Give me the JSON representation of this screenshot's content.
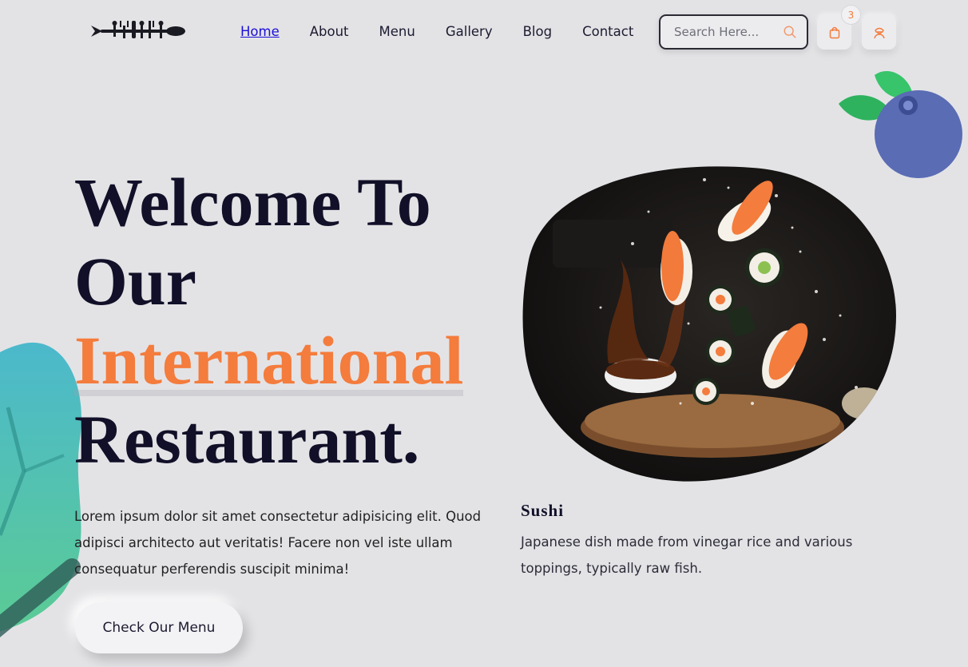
{
  "header": {
    "nav": [
      {
        "label": "Home",
        "active": true
      },
      {
        "label": "About"
      },
      {
        "label": "Menu"
      },
      {
        "label": "Gallery"
      },
      {
        "label": "Blog"
      },
      {
        "label": "Contact"
      }
    ],
    "search": {
      "placeholder": "Search Here..."
    },
    "cart_count": "3",
    "icons": {
      "search": "search-icon",
      "cart": "shopping-bag-icon",
      "user": "user-icon",
      "logo": "cutlery-fish-logo"
    }
  },
  "hero": {
    "title_line1": "Welcome To",
    "title_line2": "Our",
    "title_accent": "International",
    "title_line4": "Restaurant.",
    "description": "Lorem ipsum dolor sit amet consectetur adipisicing elit. Quod adipisci architecto aut veritatis! Facere non vel iste ullam consequatur perferendis suscipit minima!",
    "cta_label": "Check Our Menu"
  },
  "dish": {
    "name": "Sushi",
    "description": "Japanese dish made from vinegar rice and various toppings, typically raw fish."
  },
  "colors": {
    "accent": "#f47c3c",
    "background": "#e3e3e6",
    "heading": "#111028",
    "nav_active": "#1a0ed8"
  }
}
